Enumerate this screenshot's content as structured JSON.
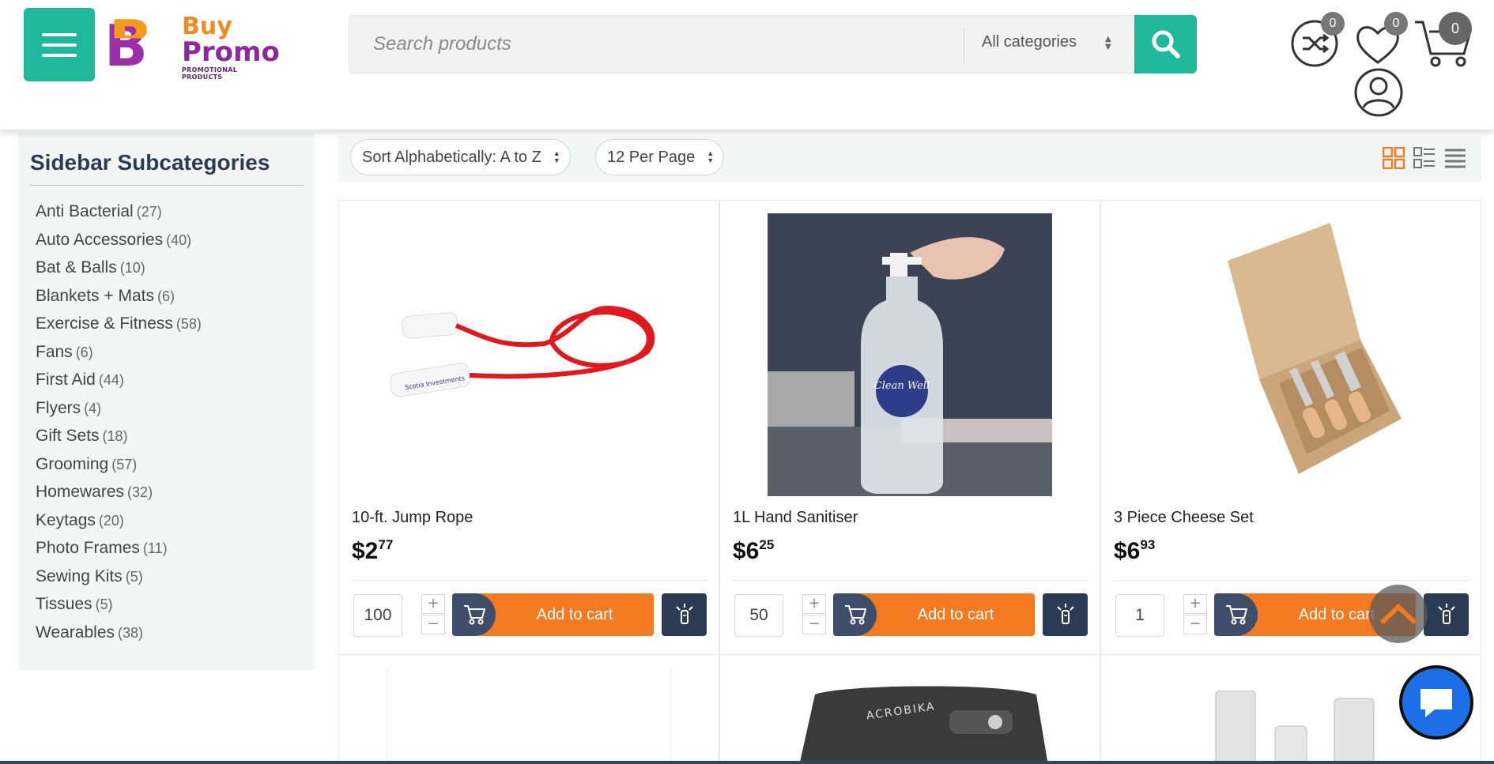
{
  "header": {
    "logo": {
      "line1": "Buy",
      "line2": "Promo",
      "tagline": "PROMOTIONAL PRODUCTS",
      "mark": "B"
    },
    "search": {
      "placeholder": "Search products",
      "category": "All categories"
    },
    "compare_count": "0",
    "wishlist_count": "0",
    "cart_count": "0"
  },
  "colors": {
    "accent": "#1fb89a",
    "cart": "#f37a20",
    "dark": "#2b3a55",
    "heading": "#2a3c55"
  },
  "sidebar": {
    "title": "Sidebar Subcategories",
    "items": [
      {
        "label": "Anti Bacterial",
        "count": "(27)"
      },
      {
        "label": "Auto Accessories",
        "count": "(40)"
      },
      {
        "label": "Bat & Balls",
        "count": "(10)"
      },
      {
        "label": "Blankets + Mats",
        "count": "(6)"
      },
      {
        "label": "Exercise & Fitness",
        "count": "(58)"
      },
      {
        "label": "Fans",
        "count": "(6)"
      },
      {
        "label": "First Aid",
        "count": "(44)"
      },
      {
        "label": "Flyers",
        "count": "(4)"
      },
      {
        "label": "Gift Sets",
        "count": "(18)"
      },
      {
        "label": "Grooming",
        "count": "(57)"
      },
      {
        "label": "Homewares",
        "count": "(32)"
      },
      {
        "label": "Keytags",
        "count": "(20)"
      },
      {
        "label": "Photo Frames",
        "count": "(11)"
      },
      {
        "label": "Sewing Kits",
        "count": "(5)"
      },
      {
        "label": "Tissues",
        "count": "(5)"
      },
      {
        "label": "Wearables",
        "count": "(38)"
      }
    ]
  },
  "toolbar": {
    "sort": "Sort Alphabetically: A to Z",
    "per_page": "12 Per Page",
    "views": [
      "grid-view-icon",
      "small-list-view-icon",
      "list-view-icon"
    ]
  },
  "products": [
    {
      "name": "10-ft. Jump Rope",
      "price_dollars": "$2",
      "price_cents": "77",
      "qty": "100",
      "add_label": "Add to cart",
      "image": "jump-rope",
      "print": "Scotia Investments"
    },
    {
      "name": "1L Hand Sanitiser",
      "price_dollars": "$6",
      "price_cents": "25",
      "qty": "50",
      "add_label": "Add to cart",
      "image": "hand-sanitiser",
      "print": "Clean Well"
    },
    {
      "name": "3 Piece Cheese Set",
      "price_dollars": "$6",
      "price_cents": "93",
      "qty": "1",
      "add_label": "Add to cart",
      "image": "cheese-set"
    }
  ],
  "lower_products": [
    {
      "image": "blank"
    },
    {
      "image": "card-wallet",
      "print": "ACROBIKA"
    },
    {
      "image": "bottles"
    }
  ],
  "steppers": {
    "plus": "+",
    "minus": "−"
  }
}
